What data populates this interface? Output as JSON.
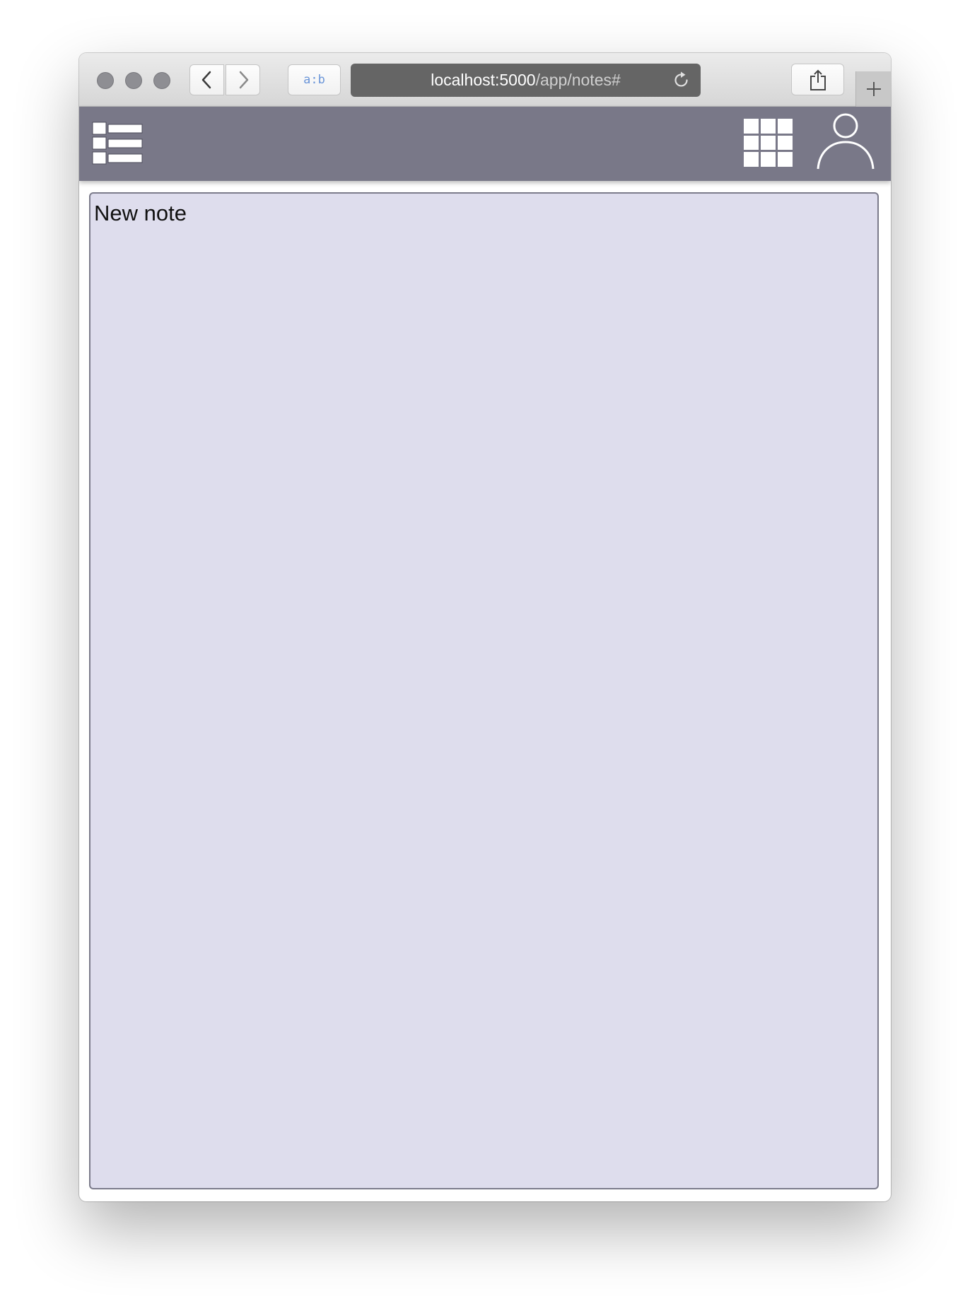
{
  "browser": {
    "reader_label": "a:b",
    "url_host": "localhost:5000",
    "url_path": "/app/notes#",
    "icons": {
      "back": "chevron-left-icon",
      "forward": "chevron-right-icon",
      "reload": "reload-icon",
      "share": "share-icon",
      "new_tab": "plus-icon"
    }
  },
  "app": {
    "header_color": "#797888",
    "icons": {
      "menu": "list-menu-icon",
      "apps": "grid-icon",
      "user": "user-icon"
    }
  },
  "note": {
    "text": "New note",
    "background": "#dedded"
  }
}
